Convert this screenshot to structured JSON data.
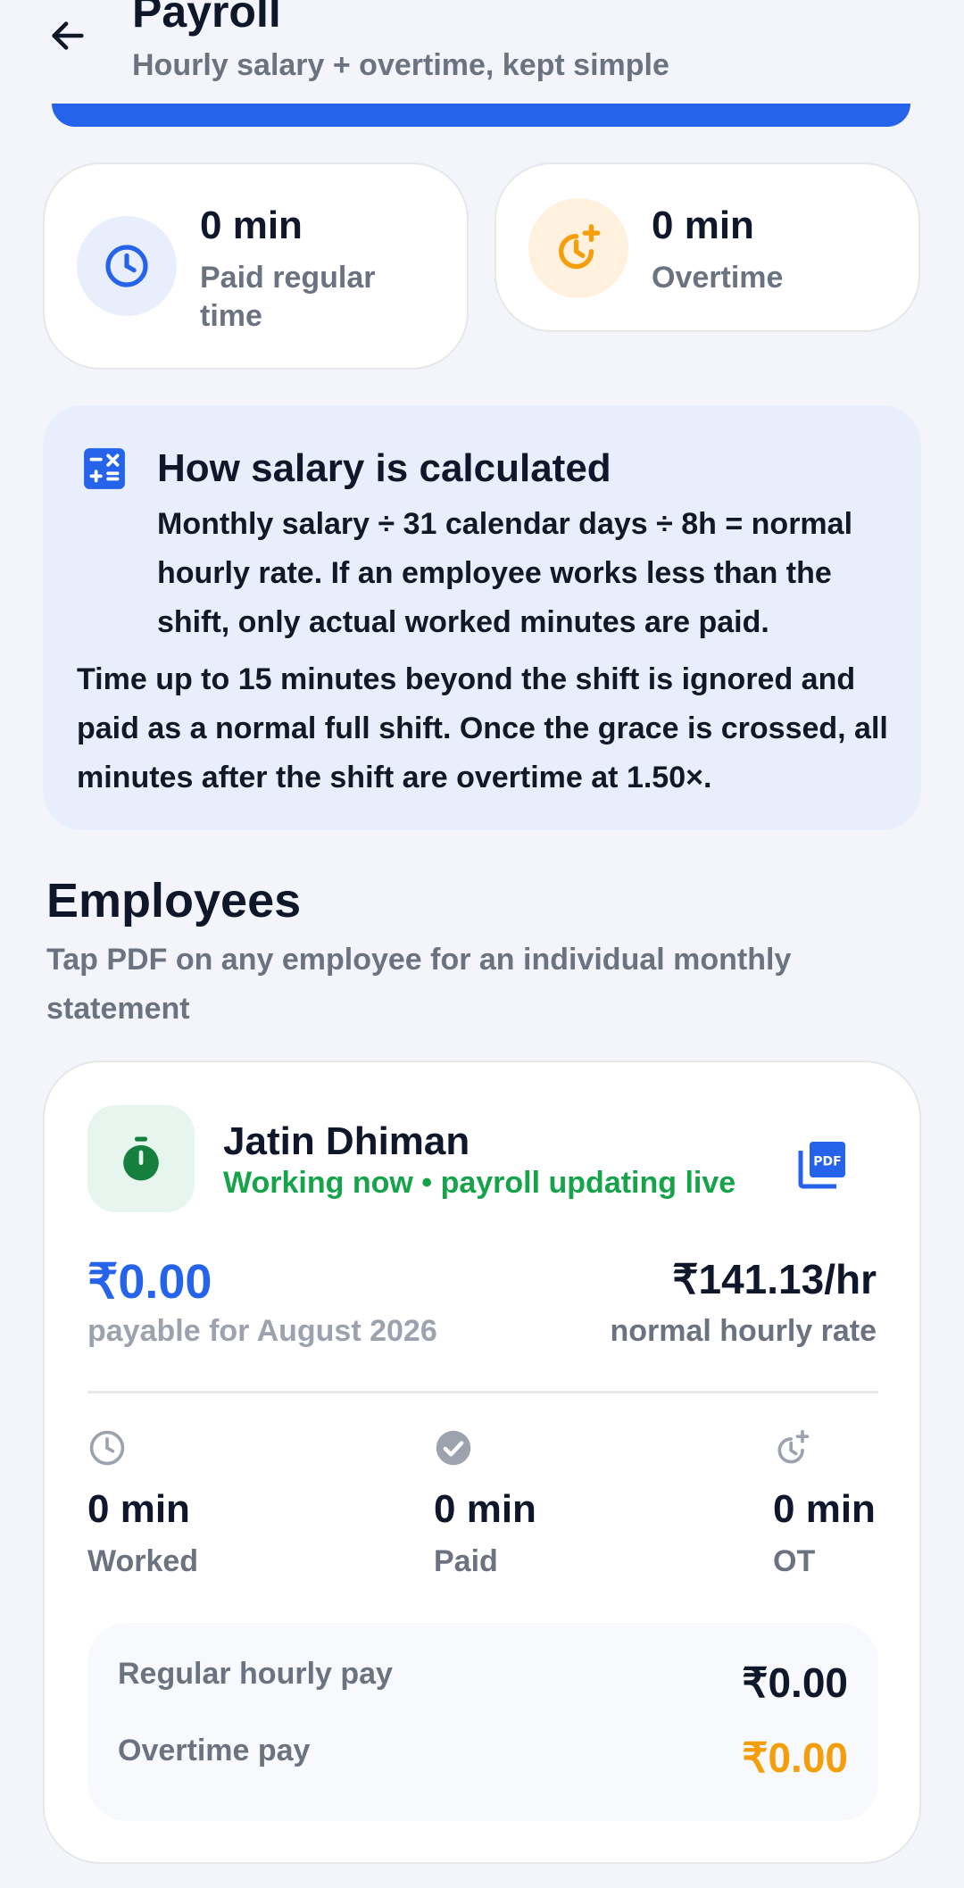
{
  "header": {
    "title": "Payroll",
    "subtitle": "Hourly salary + overtime, kept simple",
    "back_icon": "arrow-left-icon"
  },
  "stats": [
    {
      "value": "0 min",
      "label": "Paid regular time",
      "icon": "clock-icon",
      "accent": "#2563eb"
    },
    {
      "value": "0 min",
      "label": "Overtime",
      "icon": "clock-plus-icon",
      "accent": "#f59e0b"
    }
  ],
  "info": {
    "icon": "calculator-icon",
    "title": "How salary is calculated",
    "text1": "Monthly salary ÷ 31 calendar days ÷ 8h = normal hourly rate. If an employee works less than the shift, only actual worked minutes are paid.",
    "text2": "Time up to 15 minutes beyond the shift is ignored and paid as a normal full shift. Once the grace is crossed, all minutes after the shift are overtime at 1.50×."
  },
  "employees": {
    "title": "Employees",
    "subtitle": "Tap PDF on any employee for an individual monthly statement",
    "list": [
      {
        "name": "Jatin Dhiman",
        "status": "Working now • payroll updating live",
        "avatar_icon": "stopwatch-icon",
        "pdf_icon": "pdf-icon",
        "amount": "₹0.00",
        "amount_label": "payable for August 2026",
        "rate": "₹141.13/hr",
        "rate_label": "normal hourly rate",
        "metrics": [
          {
            "value": "0 min",
            "label": "Worked",
            "icon": "clock-icon"
          },
          {
            "value": "0 min",
            "label": "Paid",
            "icon": "check-circle-icon"
          },
          {
            "value": "0 min",
            "label": "OT",
            "icon": "clock-plus-icon"
          }
        ],
        "pay": [
          {
            "label": "Regular hourly pay",
            "value": "₹0.00"
          },
          {
            "label": "Overtime pay",
            "value": "₹0.00"
          }
        ]
      }
    ]
  },
  "colors": {
    "primary": "#2563eb",
    "overtime": "#f59e0b",
    "success": "#16a34a",
    "background": "#f3f5fa"
  }
}
